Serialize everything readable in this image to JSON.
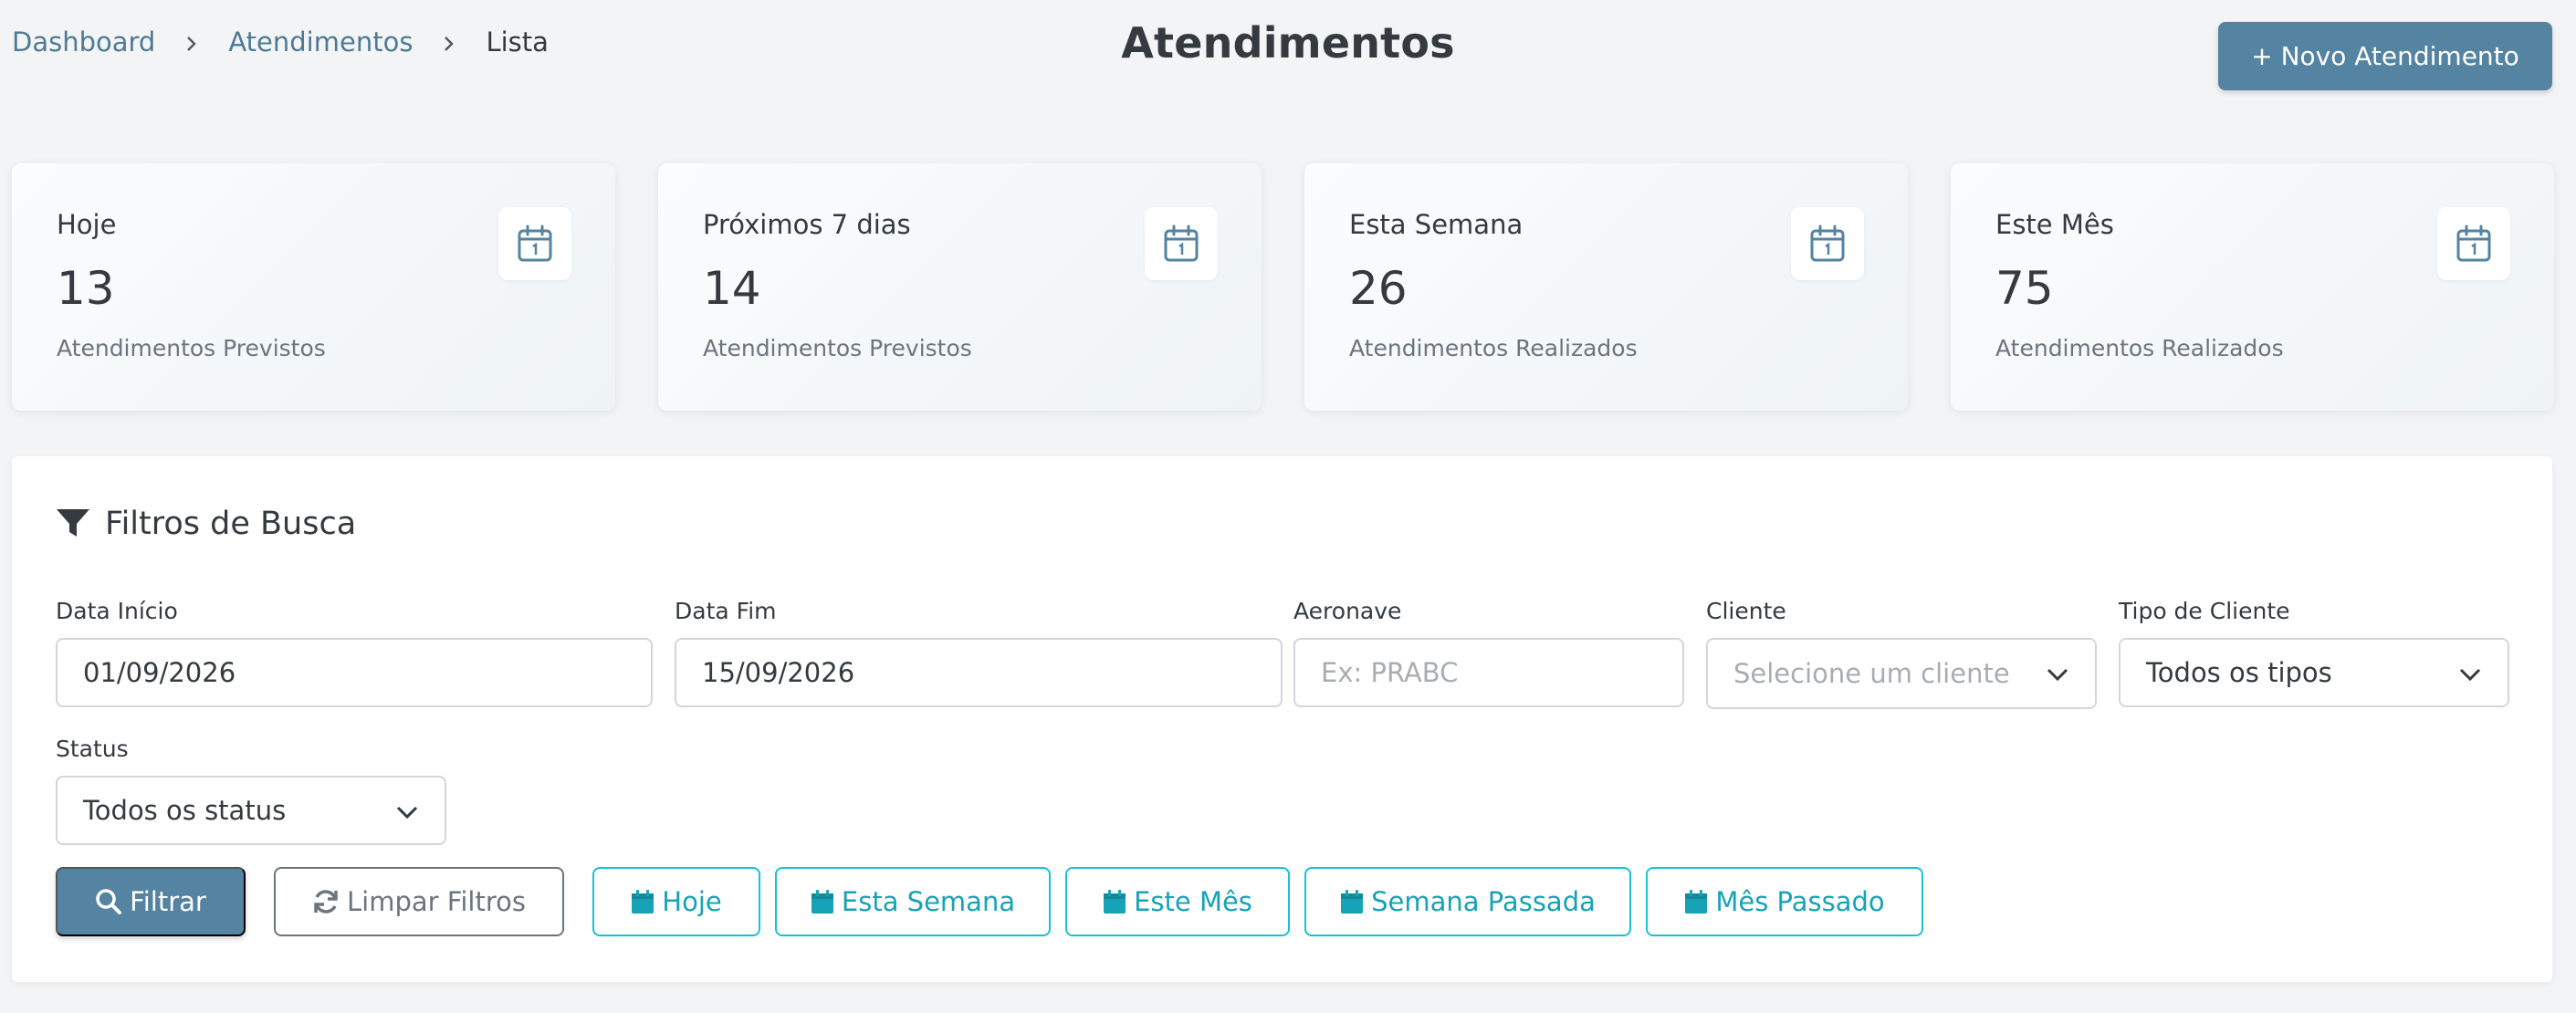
{
  "breadcrumb": {
    "items": [
      "Dashboard",
      "Atendimentos"
    ],
    "current": "Lista"
  },
  "header": {
    "title": "Atendimentos",
    "new_button": "+ Novo Atendimento"
  },
  "stats": [
    {
      "label": "Hoje",
      "value": "13",
      "desc": "Atendimentos Previstos",
      "icon": "calendar-icon"
    },
    {
      "label": "Próximos 7 dias",
      "value": "14",
      "desc": "Atendimentos Previstos",
      "icon": "calendar-icon"
    },
    {
      "label": "Esta Semana",
      "value": "26",
      "desc": "Atendimentos Realizados",
      "icon": "calendar-icon"
    },
    {
      "label": "Este Mês",
      "value": "75",
      "desc": "Atendimentos Realizados",
      "icon": "calendar-icon"
    }
  ],
  "filters": {
    "title": "Filtros de Busca",
    "data_inicio": {
      "label": "Data Início",
      "value": "01/09/2026"
    },
    "data_fim": {
      "label": "Data Fim",
      "value": "15/09/2026"
    },
    "aeronave": {
      "label": "Aeronave",
      "placeholder": "Ex: PRABC",
      "value": ""
    },
    "cliente": {
      "label": "Cliente",
      "value": "Selecione um cliente"
    },
    "tipo_cliente": {
      "label": "Tipo de Cliente",
      "value": "Todos os tipos"
    },
    "status": {
      "label": "Status",
      "value": "Todos os status"
    },
    "buttons": {
      "filtrar": "Filtrar",
      "limpar": "Limpar Filtros",
      "hoje": "Hoje",
      "esta_semana": "Esta Semana",
      "este_mes": "Este Mês",
      "semana_passada": "Semana Passada",
      "mes_passado": "Mês Passado"
    }
  },
  "colors": {
    "primary": "#5583a2",
    "link": "#4f7a94",
    "cyan": "#17a2b8",
    "background": "#f3f4f6"
  }
}
